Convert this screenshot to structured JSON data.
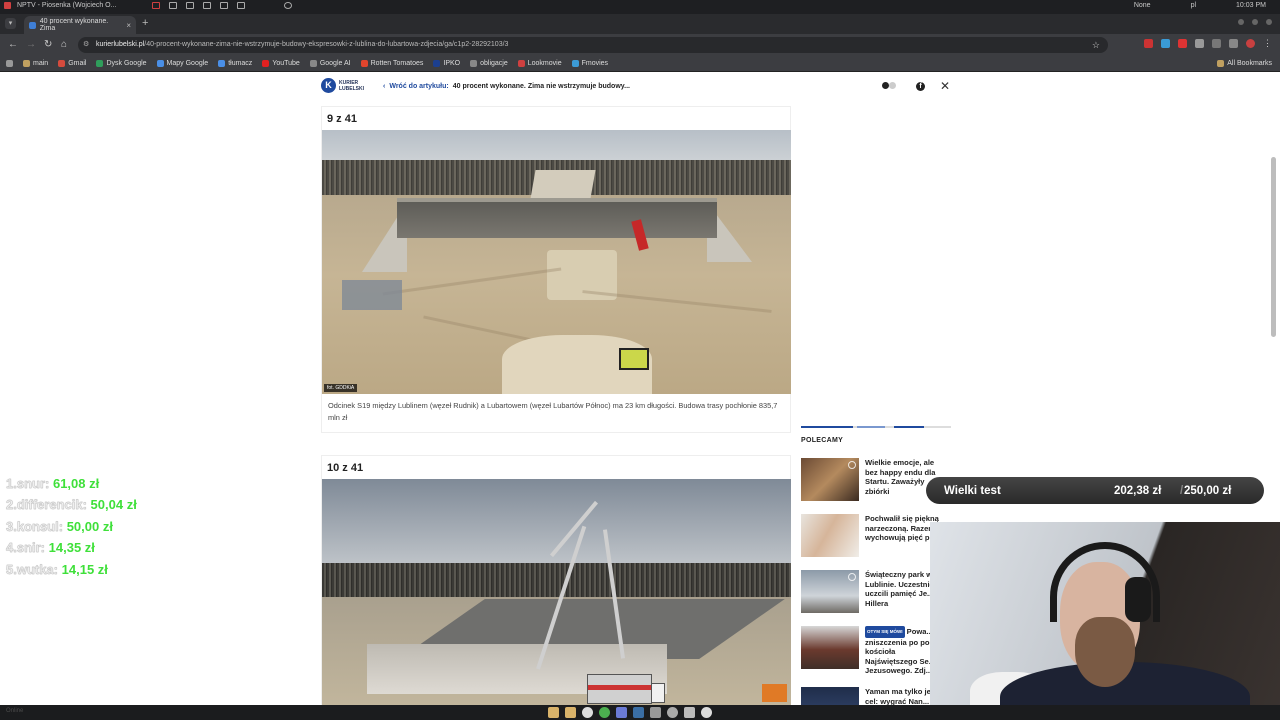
{
  "os_bar": {
    "app_title": "NPTV - Piosenka (Wojciech O...",
    "status_none": "None",
    "lang": "pl",
    "clock": "10:03 PM"
  },
  "browser": {
    "tab_title": "40 procent wykonane. Zima",
    "url_domain": "kurierlubelski.pl",
    "url_path": "/40-procent-wykonane-zima-nie-wstrzymuje-budowy-ekspresowki-z-lublina-do-lubartowa-zdjecia/ga/c1p2-28292103/3",
    "bookmarks": [
      {
        "label": "main",
        "color": "#c0a060"
      },
      {
        "label": "Gmail",
        "color": "#d54b3d"
      },
      {
        "label": "Dysk Google",
        "color": "#2f9e5b"
      },
      {
        "label": "Mapy Google",
        "color": "#4a8fe7"
      },
      {
        "label": "tłumacz",
        "color": "#4a8fe7"
      },
      {
        "label": "YouTube",
        "color": "#e02020"
      },
      {
        "label": "Google AI",
        "color": "#888888"
      },
      {
        "label": "Rotten Tomatoes",
        "color": "#e0452d"
      },
      {
        "label": "IPKO",
        "color": "#1c3f8f"
      },
      {
        "label": "obligacje",
        "color": "#888888"
      },
      {
        "label": "Lookmovie",
        "color": "#d04040"
      },
      {
        "label": "Fmovies",
        "color": "#3c9bd6"
      }
    ],
    "all_bookmarks": "All Bookmarks"
  },
  "header": {
    "logo_line1": "KURIER",
    "logo_line2": "LUBELSKI",
    "back_label": "Wróć do artykułu:",
    "article_title": "40 procent wykonane. Zima nie wstrzymuje budowy..."
  },
  "gallery": [
    {
      "counter": "9 z 41",
      "credit": "fot. GDDKiA",
      "caption": "Odcinek S19 między Lublinem (węzeł Rudnik) a Lubartowem (węzeł Lubartów Północ) ma 23 km długości. Budowa trasy pochłonie 835,7 mln zł"
    },
    {
      "counter": "10 z 41"
    }
  ],
  "sidebar": {
    "heading": "POLECAMY",
    "items": [
      {
        "title": "Wielkie emocje, ale bez happy endu dla Startu. Zaważyły zbiórki",
        "tag": ""
      },
      {
        "title": "Pochwalił się piękną narzeczoną. Razem wychowują pięć p...",
        "tag": ""
      },
      {
        "title": "Świąteczny park w Lublinie. Uczestnicy uczcili pamięć Je... Hillera",
        "tag": ""
      },
      {
        "title": "Powa... zniszczenia po po... kościoła Najświętszego Se... Jezusowego. Zdj...",
        "tag": "OTYM SIĘ MÓWI"
      },
      {
        "title": "Yaman ma tylko je... cel: wygrać Nan...",
        "tag": ""
      }
    ]
  },
  "overlay_ranking": [
    {
      "name": "1.snur:",
      "amount": "61,08 zł"
    },
    {
      "name": "2.differencik:",
      "amount": "50,04 zł"
    },
    {
      "name": "3.konsul:",
      "amount": "50,00 zł"
    },
    {
      "name": "4.snir:",
      "amount": "14,35 zł"
    },
    {
      "name": "5.wutka:",
      "amount": "14,15 zł"
    }
  ],
  "goal_widget": {
    "label": "Wielki test",
    "current": "202,38 zł",
    "separator": "/",
    "target": "250,00 zł"
  },
  "taskbar": {
    "status": "Online"
  }
}
